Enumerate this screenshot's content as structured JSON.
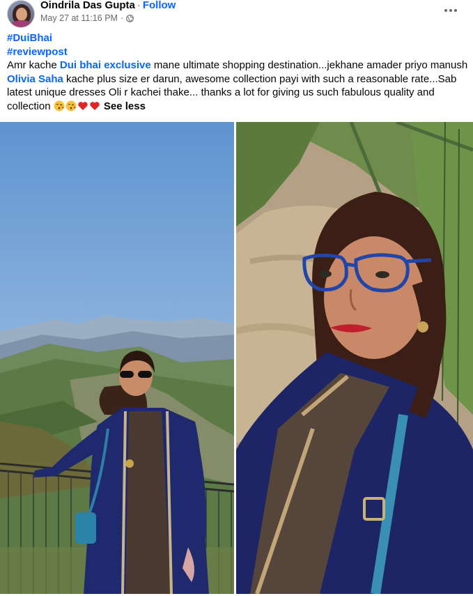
{
  "post": {
    "author": {
      "name": "Oindrila Das Gupta",
      "separator": "·",
      "follow_label": "Follow"
    },
    "meta": {
      "timestamp": "May 27 at 11:16 PM",
      "separator": "·",
      "audience_icon": "globe-icon"
    },
    "more_icon": "more-horizontal-icon",
    "hashtags": [
      "#DuiBhai",
      "#reviewpost"
    ],
    "body": {
      "part1": "Amr kache ",
      "mention1": "Dui bhai exclusive",
      "part2": " mane ultimate shopping destination...jekhane amader priyo manush ",
      "mention2": "Olivia Saha",
      "part3": " kache plus size er darun, awesome collection payi with such a reasonable rate...Sab latest unique dresses Oli r kachei thake... thanks a lot for giving us such fabulous quality and collection ",
      "emojis": [
        "kissing-face-emoji",
        "kissing-face-emoji",
        "red-heart-emoji",
        "red-heart-emoji"
      ],
      "see_less": "See less"
    },
    "photos": [
      "photo-mountain-view",
      "photo-selfie-trail"
    ],
    "colors": {
      "link": "#0866ff",
      "text": "#050505",
      "secondary": "#65676b"
    }
  }
}
